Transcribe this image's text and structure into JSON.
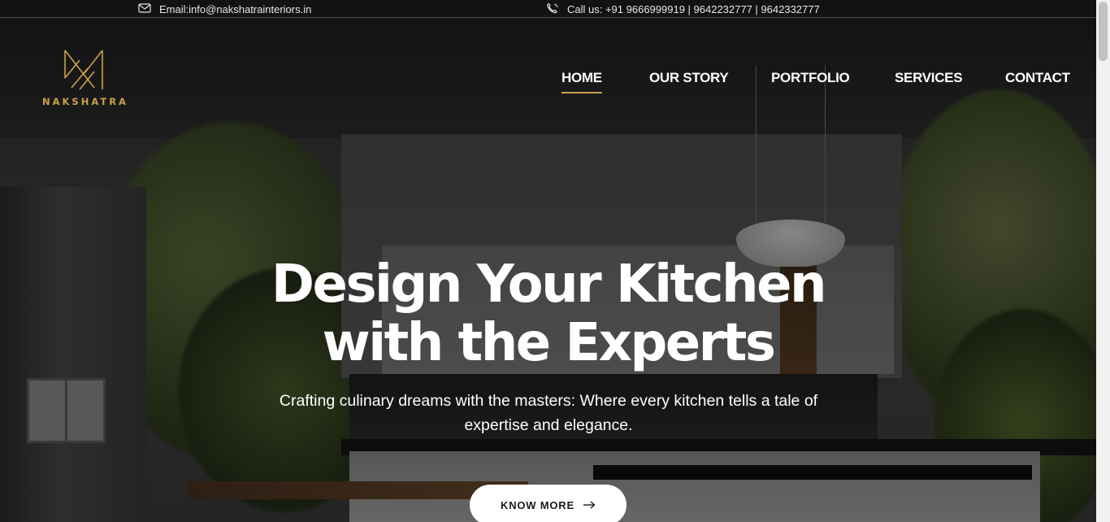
{
  "topbar": {
    "email_text": "Email:info@nakshatrainteriors.in",
    "email_icon": "mail-icon",
    "phone_text": "Call us: +91 9666999919 | 9642232777 | 9642332777",
    "phone_icon": "phone-icon"
  },
  "brand": {
    "name": "NAKSHATRA",
    "logo_icon": "nakshatra-logo-icon",
    "accent_color": "#c9a24a"
  },
  "nav": {
    "items": [
      {
        "label": "HOME",
        "active": true
      },
      {
        "label": "OUR STORY",
        "active": false
      },
      {
        "label": "PORTFOLIO",
        "active": false
      },
      {
        "label": "SERVICES",
        "active": false
      },
      {
        "label": "CONTACT",
        "active": false
      }
    ]
  },
  "hero": {
    "headline_line1": "Design Your Kitchen",
    "headline_line2": "with the Experts",
    "subtext": "Crafting culinary dreams with the masters: Where every kitchen tells a tale of expertise and elegance.",
    "cta_label": "KNOW MORE",
    "cta_icon": "arrow-right-icon"
  }
}
